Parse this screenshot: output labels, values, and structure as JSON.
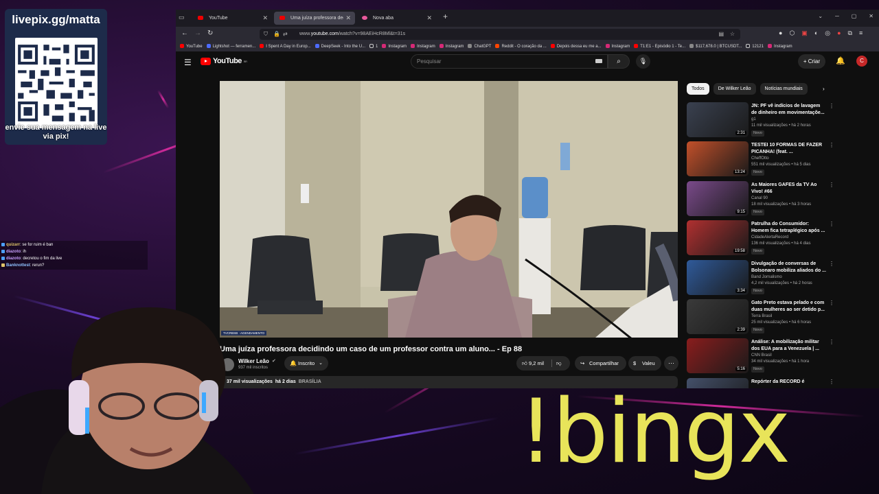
{
  "overlay": {
    "pix_url": "livepix.gg/matta",
    "pix_caption": "envie sua mensagem na live via pix!",
    "command": "!bingx",
    "chat": [
      {
        "user": "quizarr",
        "text": "se for ruim é ban"
      },
      {
        "user": "diazoto",
        "text": "ih"
      },
      {
        "user": "diazoto",
        "text": "decretou o fim da live"
      },
      {
        "user": "Banknottest",
        "text": "rerun?"
      }
    ]
  },
  "browser": {
    "tabs": [
      {
        "label": "YouTube"
      },
      {
        "label": "Uma juíza professora decid"
      },
      {
        "label": "Nova aba"
      }
    ],
    "new_tab": "+",
    "url_prefix": "www.",
    "url_host": "youtube.com",
    "url_path": "/watch?v=98AEiHcR8Ml&t=31s",
    "bookmarks": [
      {
        "label": "YouTube",
        "icon": "youtube-icon"
      },
      {
        "label": "Lightshot — ferramen...",
        "icon": "lightshot-icon"
      },
      {
        "label": "I Spent A Day in Europ...",
        "icon": "youtube-icon"
      },
      {
        "label": "DeepSeek - Into the U...",
        "icon": "deepseek-icon"
      },
      {
        "label": "1",
        "icon": "folder-icon"
      },
      {
        "label": "Instagram",
        "icon": "instagram-icon"
      },
      {
        "label": "Instagram",
        "icon": "instagram-icon"
      },
      {
        "label": "Instagram",
        "icon": "instagram-icon"
      },
      {
        "label": "ChatGPT",
        "icon": "chatgpt-icon"
      },
      {
        "label": "Reddit - O coração da ...",
        "icon": "reddit-icon"
      },
      {
        "label": "Depois dessa eu me a...",
        "icon": "youtube-icon"
      },
      {
        "label": "Instagram",
        "icon": "instagram-icon"
      },
      {
        "label": "T1:E1 - Episódio 1 - Te...",
        "icon": "youtube-icon"
      },
      {
        "label": "$117,678.0 | BTCUSDT...",
        "icon": "chart-icon"
      },
      {
        "label": "12121",
        "icon": "folder-icon"
      },
      {
        "label": "Instagram",
        "icon": "instagram-icon"
      }
    ]
  },
  "youtube": {
    "logo": "YouTube",
    "logo_region": "BR",
    "search_placeholder": "Pesquisar",
    "create_label": "Criar",
    "avatar_letter": "C",
    "player_badge": "TVCRBSB · AGENDAMENTO",
    "video_title": "Uma juíza professora decidindo um caso de um professor contra um aluno... - Ep 88",
    "channel_name": "Wilker Leão",
    "channel_subs": "937 mil inscritos",
    "subscribe_label": "Inscrito",
    "likes": "9,2 mil",
    "share_label": "Compartilhar",
    "thanks_label": "Valeu",
    "views": "37 mil visualizações",
    "age": "há 2 dias",
    "location_tag": "BRASÍLIA",
    "chips": [
      "Todos",
      "De Wilker Leão",
      "Notícias mundiais"
    ],
    "recommendations": [
      {
        "title": "JN: PF vê indícios de lavagem de dinheiro em movimentaçõe...",
        "channel": "g1",
        "meta": "11 mil visualizações • há 2 horas",
        "duration": "2:31",
        "new": "Novo",
        "thumb_color": "#3a4150"
      },
      {
        "title": "TESTEI 10 FORMAS DE FAZER PICANHA! (feat. ...",
        "channel": "CheffOtto",
        "meta": "551 mil visualizações • há 5 dias",
        "duration": "13:24",
        "new": "Novo",
        "thumb_color": "#c2502a"
      },
      {
        "title": "As Maiores GAFES da TV Ao Vivo! #66",
        "channel": "Canal 90",
        "meta": "18 mil visualizações • há 3 horas",
        "duration": "9:15",
        "new": "Novo",
        "thumb_color": "#7a4a8a"
      },
      {
        "title": "Patrulha do Consumidor: Homem fica tetraplégico após ...",
        "channel": "CidadeAlertaRecord",
        "meta": "136 mil visualizações • há 4 dias",
        "duration": "19:58",
        "new": "Novo",
        "thumb_color": "#b03030"
      },
      {
        "title": "Divulgação de conversas de Bolsonaro mobiliza aliados do ...",
        "channel": "Band Jornalismo",
        "meta": "4,2 mil visualizações • há 2 horas",
        "duration": "3:34",
        "new": "Novo",
        "thumb_color": "#2f5a9a"
      },
      {
        "title": "Gato Preto estava pelado e com duas mulheres ao ser detido p...",
        "channel": "Terra Brasil",
        "meta": "25 mil visualizações • há 6 horas",
        "duration": "2:39",
        "new": "Novo",
        "thumb_color": "#3a3a3a"
      },
      {
        "title": "Análise: A mobilização militar dos EUA para a Venezuela | ...",
        "channel": "CNN Brasil",
        "meta": "34 mil visualizações • há 1 hora",
        "duration": "5:16",
        "new": "Novo",
        "thumb_color": "#8a1d1d"
      },
      {
        "title": "Repórter da RECORD é",
        "channel": "",
        "meta": "",
        "duration": "",
        "new": "",
        "thumb_color": "#44506a"
      }
    ]
  }
}
